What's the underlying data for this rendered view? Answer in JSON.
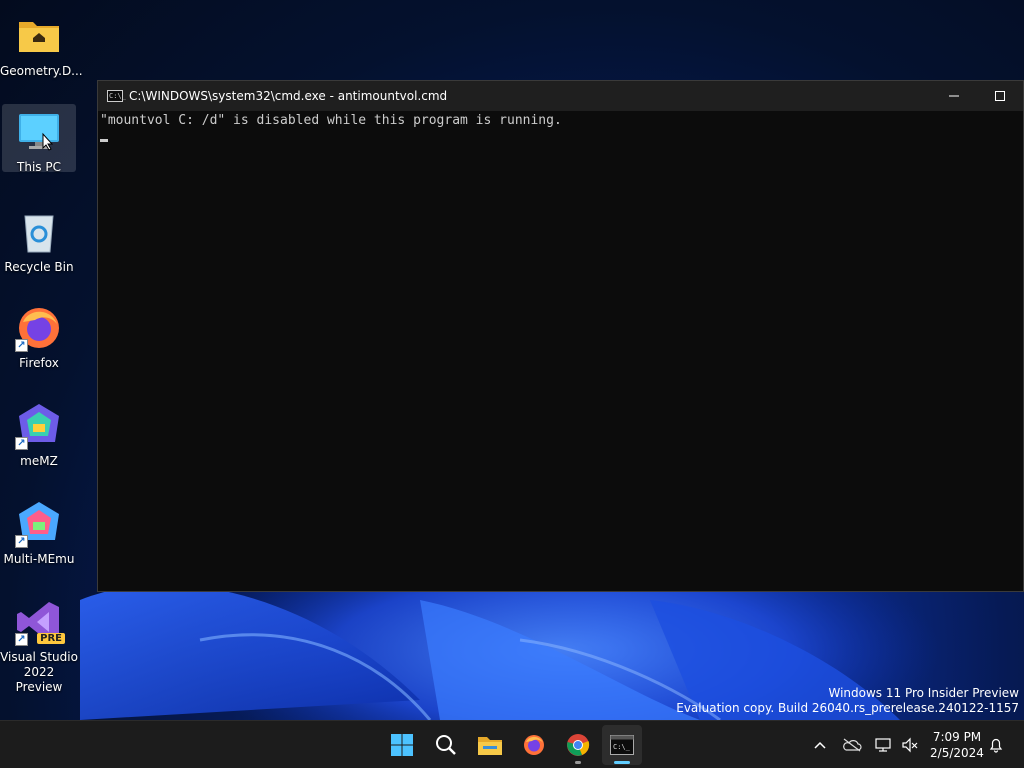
{
  "desktop": {
    "icons": [
      {
        "label": "Geometry.D..."
      },
      {
        "label": "This PC"
      },
      {
        "label": "Recycle Bin"
      },
      {
        "label": "Firefox"
      },
      {
        "label": "meMZ"
      },
      {
        "label": "Multi-MEmu"
      },
      {
        "label": "Visual Studio 2022 Preview",
        "badge": "PRE"
      }
    ]
  },
  "cmd_window": {
    "title": "C:\\WINDOWS\\system32\\cmd.exe - antimountvol.cmd",
    "icon_text": "C:\\_",
    "minimize_icon": "minimize-icon",
    "maximize_icon": "maximize-icon",
    "output_line": "\"mountvol C: /d\" is disabled while this program is running."
  },
  "watermark": {
    "line1": "Windows 11 Pro Insider Preview",
    "line2": "Evaluation copy. Build 26040.rs_prerelease.240122-1157"
  },
  "taskbar": {
    "apps": [
      "start-icon",
      "search-icon",
      "file-explorer-icon",
      "firefox-icon",
      "chrome-icon",
      "terminal-icon"
    ],
    "tray": [
      "chevron-up-icon",
      "onedrive-offline-icon",
      "network-icon",
      "volume-muted-icon",
      "bell-icon"
    ],
    "time": "7:09 PM",
    "date": "2/5/2024"
  },
  "colors": {
    "accent": "#60cdff",
    "console_bg": "#0c0c0c",
    "console_text": "#cccccc"
  }
}
